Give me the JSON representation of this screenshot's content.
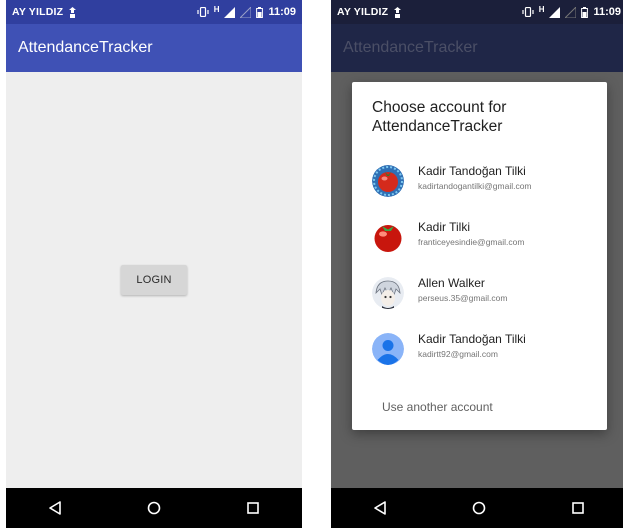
{
  "status_bar": {
    "carrier": "AY YILDIZ",
    "time": "11:09",
    "network": "H"
  },
  "app": {
    "title": "AttendanceTracker"
  },
  "left_screen": {
    "login_label": "LOGIN"
  },
  "dialog": {
    "title": "Choose account for AttendanceTracker",
    "accounts": [
      {
        "name": "Kadir Tandoğan Tilki",
        "email": "kadirtandogantilki@gmail.com",
        "avatar": "tomato-blue-frame-icon"
      },
      {
        "name": "Kadir Tilki",
        "email": "franticeyesindie@gmail.com",
        "avatar": "tomato-icon"
      },
      {
        "name": "Allen Walker",
        "email": "perseus.35@gmail.com",
        "avatar": "anime-character-icon"
      },
      {
        "name": "Kadir Tandoğan Tilki",
        "email": "kadirtt92@gmail.com",
        "avatar": "default-person-icon"
      }
    ],
    "another_account_label": "Use another account"
  },
  "nav": {
    "icons": [
      "back-icon",
      "home-icon",
      "recents-icon"
    ]
  },
  "colors": {
    "primary": "#3f51b5",
    "primary_dark": "#303f9f",
    "content_bg": "#eeeeee",
    "scrim": "#5f5f5f"
  }
}
